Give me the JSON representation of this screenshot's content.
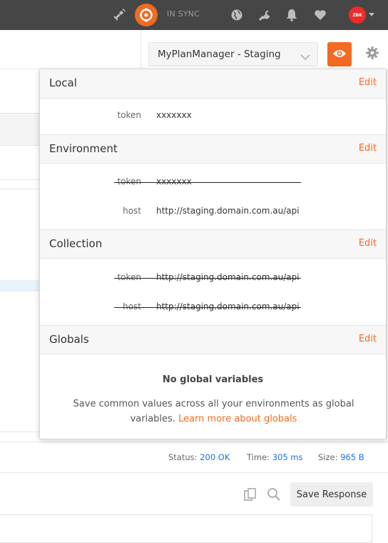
{
  "header": {
    "sync_label": "IN SYNC",
    "avatar_text": "ZBK",
    "icons": [
      "satellite-icon",
      "sync-icon",
      "globe-icon",
      "wrench-icon",
      "bell-icon",
      "heart-icon",
      "avatar",
      "chevron-down-icon"
    ]
  },
  "environment": {
    "selected": "MyPlanManager - Staging"
  },
  "popup": {
    "local": {
      "title": "Local",
      "edit": "Edit",
      "vars": [
        {
          "key": "token",
          "value": "xxxxxxx"
        }
      ]
    },
    "environment": {
      "title": "Environment",
      "edit": "Edit",
      "vars": [
        {
          "key": "token",
          "value": "xxxxxxx",
          "overridden": true
        },
        {
          "key": "host",
          "value": "http://staging.domain.com.au/api",
          "overridden": false
        }
      ]
    },
    "collection": {
      "title": "Collection",
      "edit": "Edit",
      "vars": [
        {
          "key": "token",
          "value": "http://staging.domain.com.au/api",
          "overridden": true
        },
        {
          "key": "host",
          "value": "http://staging.domain.com.au/api",
          "overridden": true
        }
      ]
    },
    "globals": {
      "title": "Globals",
      "edit": "Edit",
      "empty_title": "No global variables",
      "empty_desc": "Save common values across all your environments as global variables.",
      "learn_more": "Learn more about globals"
    }
  },
  "status": {
    "status_label": "Status:",
    "status_value": "200 OK",
    "time_label": "Time:",
    "time_value": "305 ms",
    "size_label": "Size:",
    "size_value": "965 B"
  },
  "response": {
    "save_label": "Save Response"
  },
  "colors": {
    "accent": "#f26b21",
    "header_bg": "#464646",
    "status_value": "#1a73e8"
  }
}
